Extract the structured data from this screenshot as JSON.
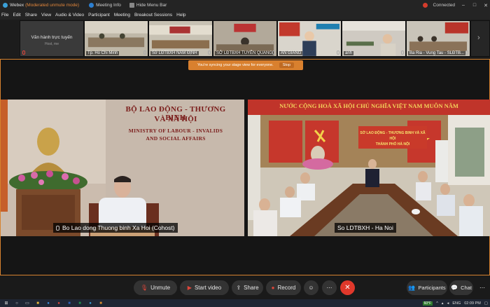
{
  "titlebar": {
    "app": "Webex",
    "status": "(Moderated unmute mode)",
    "meeting_info": "Meeting Info",
    "hide_menu": "Hide Menu Bar",
    "connection": "Connected"
  },
  "menu": [
    "File",
    "Edit",
    "Share",
    "View",
    "Audio & Video",
    "Participant",
    "Meeting",
    "Breakout Sessions",
    "Help"
  ],
  "strip": {
    "first_tile": {
      "name": "Văn hành trực tuyến",
      "role": "Host, me"
    },
    "tiles": [
      {
        "label": "Tp. Ho Chi Minh"
      },
      {
        "label": "Sở LĐTBXH NAM ĐỊNH"
      },
      {
        "label": "SỞ LĐTBXH TUYÊN QUANG"
      },
      {
        "label": "AN GIANG"
      },
      {
        "label": "anh"
      },
      {
        "label": "Ba Ria - Vung Tau - SLĐTB..."
      }
    ]
  },
  "sync_banner": {
    "text": "You're syncing your stage view for everyone.",
    "stop": "Stop"
  },
  "videos": [
    {
      "label": "Bo Lao dong Thuong binh Xa Hoi (Cohost)",
      "wall_line1": "BỘ LAO ĐỘNG - THƯƠNG BINH",
      "wall_line2": "VÀ XÃ HỘI",
      "wall_line3": "MINISTRY OF LABOUR - INVALIDS",
      "wall_line4": "AND SOCIAL AFFAIRS"
    },
    {
      "label": "So LDTBXH - Ha Noi",
      "banner": "NƯỚC CỘNG HOÀ XÃ HỘI CHỦ NGHĨA VIỆT NAM MUÔN NĂM",
      "board_line1": "SỞ LAO ĐỘNG - THƯƠNG BINH VÀ XÃ HỘI",
      "board_line2": "THÀNH PHỐ HÀ NỘI"
    }
  ],
  "controls": {
    "unmute": "Unmute",
    "start_video": "Start video",
    "share": "Share",
    "record": "Record",
    "participants": "Participants",
    "chat": "Chat"
  },
  "taskbar": {
    "weather": "60°F",
    "language": "ENG",
    "time": "02:09 PM"
  },
  "colors": {
    "accent": "#d6822f",
    "leave": "#e0382b",
    "mute_red": "#e0463a"
  }
}
